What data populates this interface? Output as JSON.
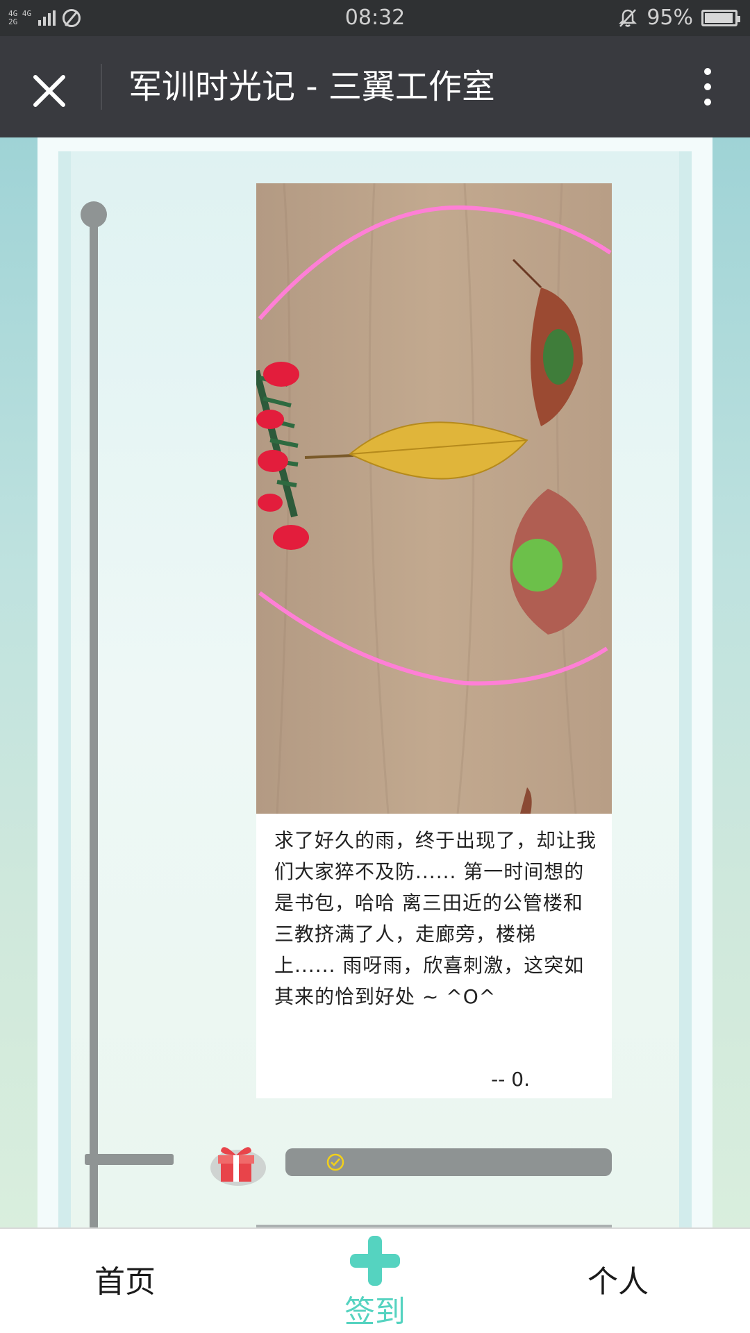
{
  "status_bar": {
    "network_top": "4G 4G",
    "network_bottom": "2G",
    "time": "08:32",
    "battery": "95%",
    "battery_level": 0.95
  },
  "title_bar": {
    "title": "军训时光记 - 三翼工作室"
  },
  "post": {
    "body": "求了好久的雨，终于出现了，却让我们大家猝不及防...... 第一时间想的是书包，哈哈 离三田近的公管楼和三教挤满了人，走廊旁，楼梯上...... 雨呀雨，欣喜刺激，这突如其来的恰到好处 ~ ^O^",
    "author": "-- 0."
  },
  "bottom_nav": {
    "home": "首页",
    "checkin": "签到",
    "me": "个人"
  },
  "colors": {
    "accent": "#55d3c0",
    "titlebar": "#393a3f",
    "statusbar": "#2f3133",
    "timeline": "#8f9494"
  }
}
